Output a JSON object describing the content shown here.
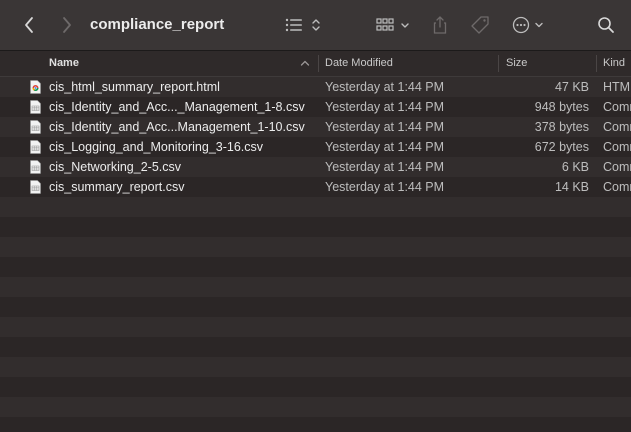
{
  "window": {
    "title": "compliance_report"
  },
  "toolbar": {
    "back_icon": "chevron-left-icon",
    "forward_icon": "chevron-right-icon",
    "list_view_icon": "list-view-icon",
    "grid_view_icon": "grid-view-icon",
    "share_icon": "share-icon",
    "tag_icon": "tag-icon",
    "more_icon": "ellipsis-circle-icon",
    "search_icon": "search-icon"
  },
  "columns": {
    "name": "Name",
    "date": "Date Modified",
    "size": "Size",
    "kind": "Kind"
  },
  "files": [
    {
      "name": "cis_html_summary_report.html",
      "date": "Yesterday at 1:44 PM",
      "size": "47 KB",
      "kind": "HTML",
      "icon": "chrome-document-icon"
    },
    {
      "name": "cis_Identity_and_Acc..._Management_1-8.csv",
      "date": "Yesterday at 1:44 PM",
      "size": "948 bytes",
      "kind": "Comma",
      "icon": "csv-document-icon"
    },
    {
      "name": "cis_Identity_and_Acc...Management_1-10.csv",
      "date": "Yesterday at 1:44 PM",
      "size": "378 bytes",
      "kind": "Comma",
      "icon": "csv-document-icon"
    },
    {
      "name": "cis_Logging_and_Monitoring_3-16.csv",
      "date": "Yesterday at 1:44 PM",
      "size": "672 bytes",
      "kind": "Comma",
      "icon": "csv-document-icon"
    },
    {
      "name": "cis_Networking_2-5.csv",
      "date": "Yesterday at 1:44 PM",
      "size": "6 KB",
      "kind": "Comma",
      "icon": "csv-document-icon"
    },
    {
      "name": "cis_summary_report.csv",
      "date": "Yesterday at 1:44 PM",
      "size": "14 KB",
      "kind": "Comma",
      "icon": "csv-document-icon"
    }
  ],
  "colors": {
    "toolbar_bg": "#3a3636",
    "row_even": "#2b2626",
    "row_odd": "#322d2d",
    "text_primary": "#ececec",
    "text_secondary": "#bdbdbd"
  }
}
